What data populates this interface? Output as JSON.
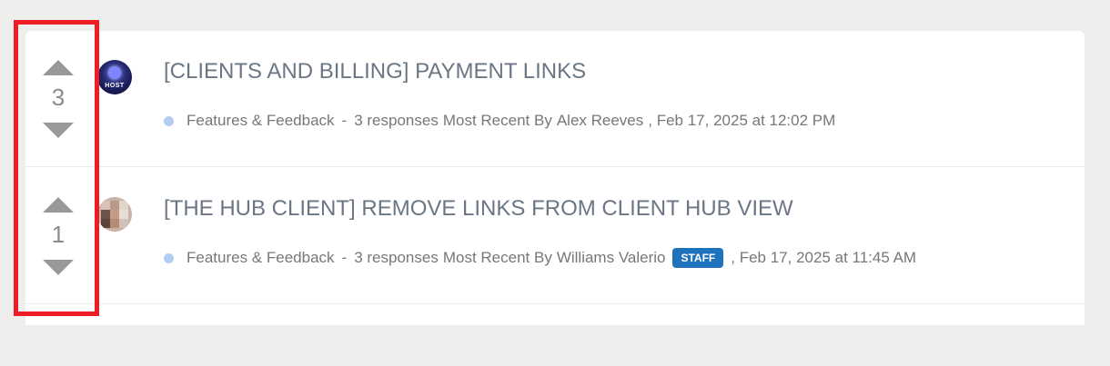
{
  "discussions": [
    {
      "score": "3",
      "title": "[CLIENTS AND BILLING] PAYMENT LINKS",
      "category": "Features & Feedback",
      "separator": "-",
      "responses": "3 responses",
      "recent_prefix": "Most Recent By",
      "author": "Alex Reeves",
      "badge": "",
      "timestamp": ", Feb 17, 2025 at 12:02 PM",
      "avatar_text": "HOST"
    },
    {
      "score": "1",
      "title": "[THE HUB CLIENT] REMOVE LINKS FROM CLIENT HUB VIEW",
      "category": "Features & Feedback",
      "separator": "-",
      "responses": "3 responses",
      "recent_prefix": "Most Recent By",
      "author": "Williams Valerio",
      "badge": "STAFF",
      "timestamp": ", Feb 17, 2025 at 11:45 AM",
      "avatar_text": ""
    }
  ],
  "colors": {
    "page_bg": "#eeefec",
    "title": "#6b7685",
    "meta": "#777777",
    "vote_arrow": "#999999",
    "category_dot": "#b3cdf3",
    "staff_badge": "#1f73bd",
    "highlight": "#ee1d23"
  },
  "icons": {
    "upvote": "upvote-arrow-icon",
    "downvote": "downvote-arrow-icon",
    "category": "category-dot-icon"
  }
}
